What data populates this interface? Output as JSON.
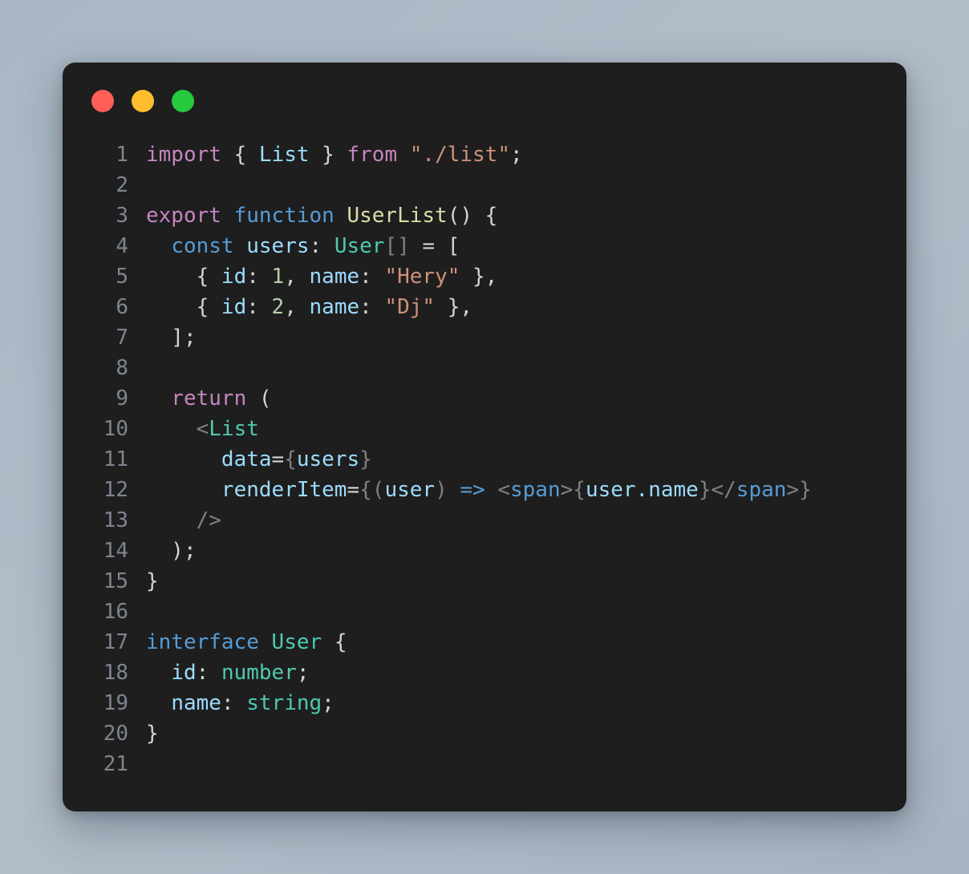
{
  "window": {
    "traffic_lights": [
      {
        "name": "close",
        "color": "#ff5f56"
      },
      {
        "name": "minimize",
        "color": "#ffbd2e"
      },
      {
        "name": "maximize",
        "color": "#27c93f"
      }
    ]
  },
  "editor": {
    "language": "typescript-react",
    "background": "#1e1e1e",
    "line_number_color": "#7d8590",
    "lines": [
      {
        "number": "1",
        "text": "import { List } from \"./list\";",
        "tokens": [
          {
            "t": "import",
            "c": "tok-keyword"
          },
          {
            "t": " ",
            "c": "tok-plain"
          },
          {
            "t": "{",
            "c": "tok-punct"
          },
          {
            "t": " ",
            "c": "tok-plain"
          },
          {
            "t": "List",
            "c": "tok-var"
          },
          {
            "t": " ",
            "c": "tok-plain"
          },
          {
            "t": "}",
            "c": "tok-punct"
          },
          {
            "t": " ",
            "c": "tok-plain"
          },
          {
            "t": "from",
            "c": "tok-keyword"
          },
          {
            "t": " ",
            "c": "tok-plain"
          },
          {
            "t": "\"./list\"",
            "c": "tok-string"
          },
          {
            "t": ";",
            "c": "tok-punct"
          }
        ]
      },
      {
        "number": "2",
        "text": "",
        "tokens": []
      },
      {
        "number": "3",
        "text": "export function UserList() {",
        "tokens": [
          {
            "t": "export",
            "c": "tok-keyword"
          },
          {
            "t": " ",
            "c": "tok-plain"
          },
          {
            "t": "function",
            "c": "tok-control"
          },
          {
            "t": " ",
            "c": "tok-plain"
          },
          {
            "t": "UserList",
            "c": "tok-func"
          },
          {
            "t": "() {",
            "c": "tok-punct"
          }
        ]
      },
      {
        "number": "4",
        "text": "  const users: User[] = [",
        "tokens": [
          {
            "t": "  ",
            "c": "tok-plain"
          },
          {
            "t": "const",
            "c": "tok-control"
          },
          {
            "t": " ",
            "c": "tok-plain"
          },
          {
            "t": "users",
            "c": "tok-var"
          },
          {
            "t": ": ",
            "c": "tok-punct"
          },
          {
            "t": "User",
            "c": "tok-type"
          },
          {
            "t": "[]",
            "c": "tok-bracket"
          },
          {
            "t": " = [",
            "c": "tok-punct"
          }
        ]
      },
      {
        "number": "5",
        "text": "    { id: 1, name: \"Hery\" },",
        "tokens": [
          {
            "t": "    { ",
            "c": "tok-punct"
          },
          {
            "t": "id",
            "c": "tok-var"
          },
          {
            "t": ": ",
            "c": "tok-punct"
          },
          {
            "t": "1",
            "c": "tok-number"
          },
          {
            "t": ", ",
            "c": "tok-punct"
          },
          {
            "t": "name",
            "c": "tok-var"
          },
          {
            "t": ": ",
            "c": "tok-punct"
          },
          {
            "t": "\"Hery\"",
            "c": "tok-string"
          },
          {
            "t": " },",
            "c": "tok-punct"
          }
        ]
      },
      {
        "number": "6",
        "text": "    { id: 2, name: \"Dj\" },",
        "tokens": [
          {
            "t": "    { ",
            "c": "tok-punct"
          },
          {
            "t": "id",
            "c": "tok-var"
          },
          {
            "t": ": ",
            "c": "tok-punct"
          },
          {
            "t": "2",
            "c": "tok-number"
          },
          {
            "t": ", ",
            "c": "tok-punct"
          },
          {
            "t": "name",
            "c": "tok-var"
          },
          {
            "t": ": ",
            "c": "tok-punct"
          },
          {
            "t": "\"Dj\"",
            "c": "tok-string"
          },
          {
            "t": " },",
            "c": "tok-punct"
          }
        ]
      },
      {
        "number": "7",
        "text": "  ];",
        "tokens": [
          {
            "t": "  ];",
            "c": "tok-punct"
          }
        ]
      },
      {
        "number": "8",
        "text": "",
        "tokens": []
      },
      {
        "number": "9",
        "text": "  return (",
        "tokens": [
          {
            "t": "  ",
            "c": "tok-plain"
          },
          {
            "t": "return",
            "c": "tok-keyword"
          },
          {
            "t": " (",
            "c": "tok-punct"
          }
        ]
      },
      {
        "number": "10",
        "text": "    <List",
        "tokens": [
          {
            "t": "    ",
            "c": "tok-plain"
          },
          {
            "t": "<",
            "c": "tok-bracket"
          },
          {
            "t": "List",
            "c": "tok-type"
          }
        ]
      },
      {
        "number": "11",
        "text": "      data={users}",
        "tokens": [
          {
            "t": "      ",
            "c": "tok-plain"
          },
          {
            "t": "data",
            "c": "tok-var"
          },
          {
            "t": "=",
            "c": "tok-plain"
          },
          {
            "t": "{",
            "c": "tok-bracket"
          },
          {
            "t": "users",
            "c": "tok-var"
          },
          {
            "t": "}",
            "c": "tok-bracket"
          }
        ]
      },
      {
        "number": "12",
        "text": "      renderItem={(user) => <span>{user.name}</span>}",
        "tokens": [
          {
            "t": "      ",
            "c": "tok-plain"
          },
          {
            "t": "renderItem",
            "c": "tok-var"
          },
          {
            "t": "=",
            "c": "tok-plain"
          },
          {
            "t": "{",
            "c": "tok-bracket"
          },
          {
            "t": "(",
            "c": "tok-bracket"
          },
          {
            "t": "user",
            "c": "tok-var"
          },
          {
            "t": ")",
            "c": "tok-bracket"
          },
          {
            "t": " ",
            "c": "tok-plain"
          },
          {
            "t": "=>",
            "c": "tok-control"
          },
          {
            "t": " ",
            "c": "tok-plain"
          },
          {
            "t": "<",
            "c": "tok-bracket"
          },
          {
            "t": "span",
            "c": "tok-control"
          },
          {
            "t": ">",
            "c": "tok-bracket"
          },
          {
            "t": "{",
            "c": "tok-bracket"
          },
          {
            "t": "user.name",
            "c": "tok-var"
          },
          {
            "t": "}",
            "c": "tok-bracket"
          },
          {
            "t": "</",
            "c": "tok-bracket"
          },
          {
            "t": "span",
            "c": "tok-control"
          },
          {
            "t": ">",
            "c": "tok-bracket"
          },
          {
            "t": "}",
            "c": "tok-bracket"
          }
        ]
      },
      {
        "number": "13",
        "text": "    />",
        "tokens": [
          {
            "t": "    ",
            "c": "tok-plain"
          },
          {
            "t": "/>",
            "c": "tok-bracket"
          }
        ]
      },
      {
        "number": "14",
        "text": "  );",
        "tokens": [
          {
            "t": "  );",
            "c": "tok-punct"
          }
        ]
      },
      {
        "number": "15",
        "text": "}",
        "tokens": [
          {
            "t": "}",
            "c": "tok-punct"
          }
        ]
      },
      {
        "number": "16",
        "text": "",
        "tokens": []
      },
      {
        "number": "17",
        "text": "interface User {",
        "tokens": [
          {
            "t": "interface",
            "c": "tok-control"
          },
          {
            "t": " ",
            "c": "tok-plain"
          },
          {
            "t": "User",
            "c": "tok-type"
          },
          {
            "t": " {",
            "c": "tok-punct"
          }
        ]
      },
      {
        "number": "18",
        "text": "  id: number;",
        "tokens": [
          {
            "t": "  ",
            "c": "tok-plain"
          },
          {
            "t": "id",
            "c": "tok-var"
          },
          {
            "t": ": ",
            "c": "tok-punct"
          },
          {
            "t": "number",
            "c": "tok-type"
          },
          {
            "t": ";",
            "c": "tok-punct"
          }
        ]
      },
      {
        "number": "19",
        "text": "  name: string;",
        "tokens": [
          {
            "t": "  ",
            "c": "tok-plain"
          },
          {
            "t": "name",
            "c": "tok-var"
          },
          {
            "t": ": ",
            "c": "tok-punct"
          },
          {
            "t": "string",
            "c": "tok-type"
          },
          {
            "t": ";",
            "c": "tok-punct"
          }
        ]
      },
      {
        "number": "20",
        "text": "}",
        "tokens": [
          {
            "t": "}",
            "c": "tok-punct"
          }
        ]
      },
      {
        "number": "21",
        "text": "",
        "tokens": []
      }
    ]
  }
}
